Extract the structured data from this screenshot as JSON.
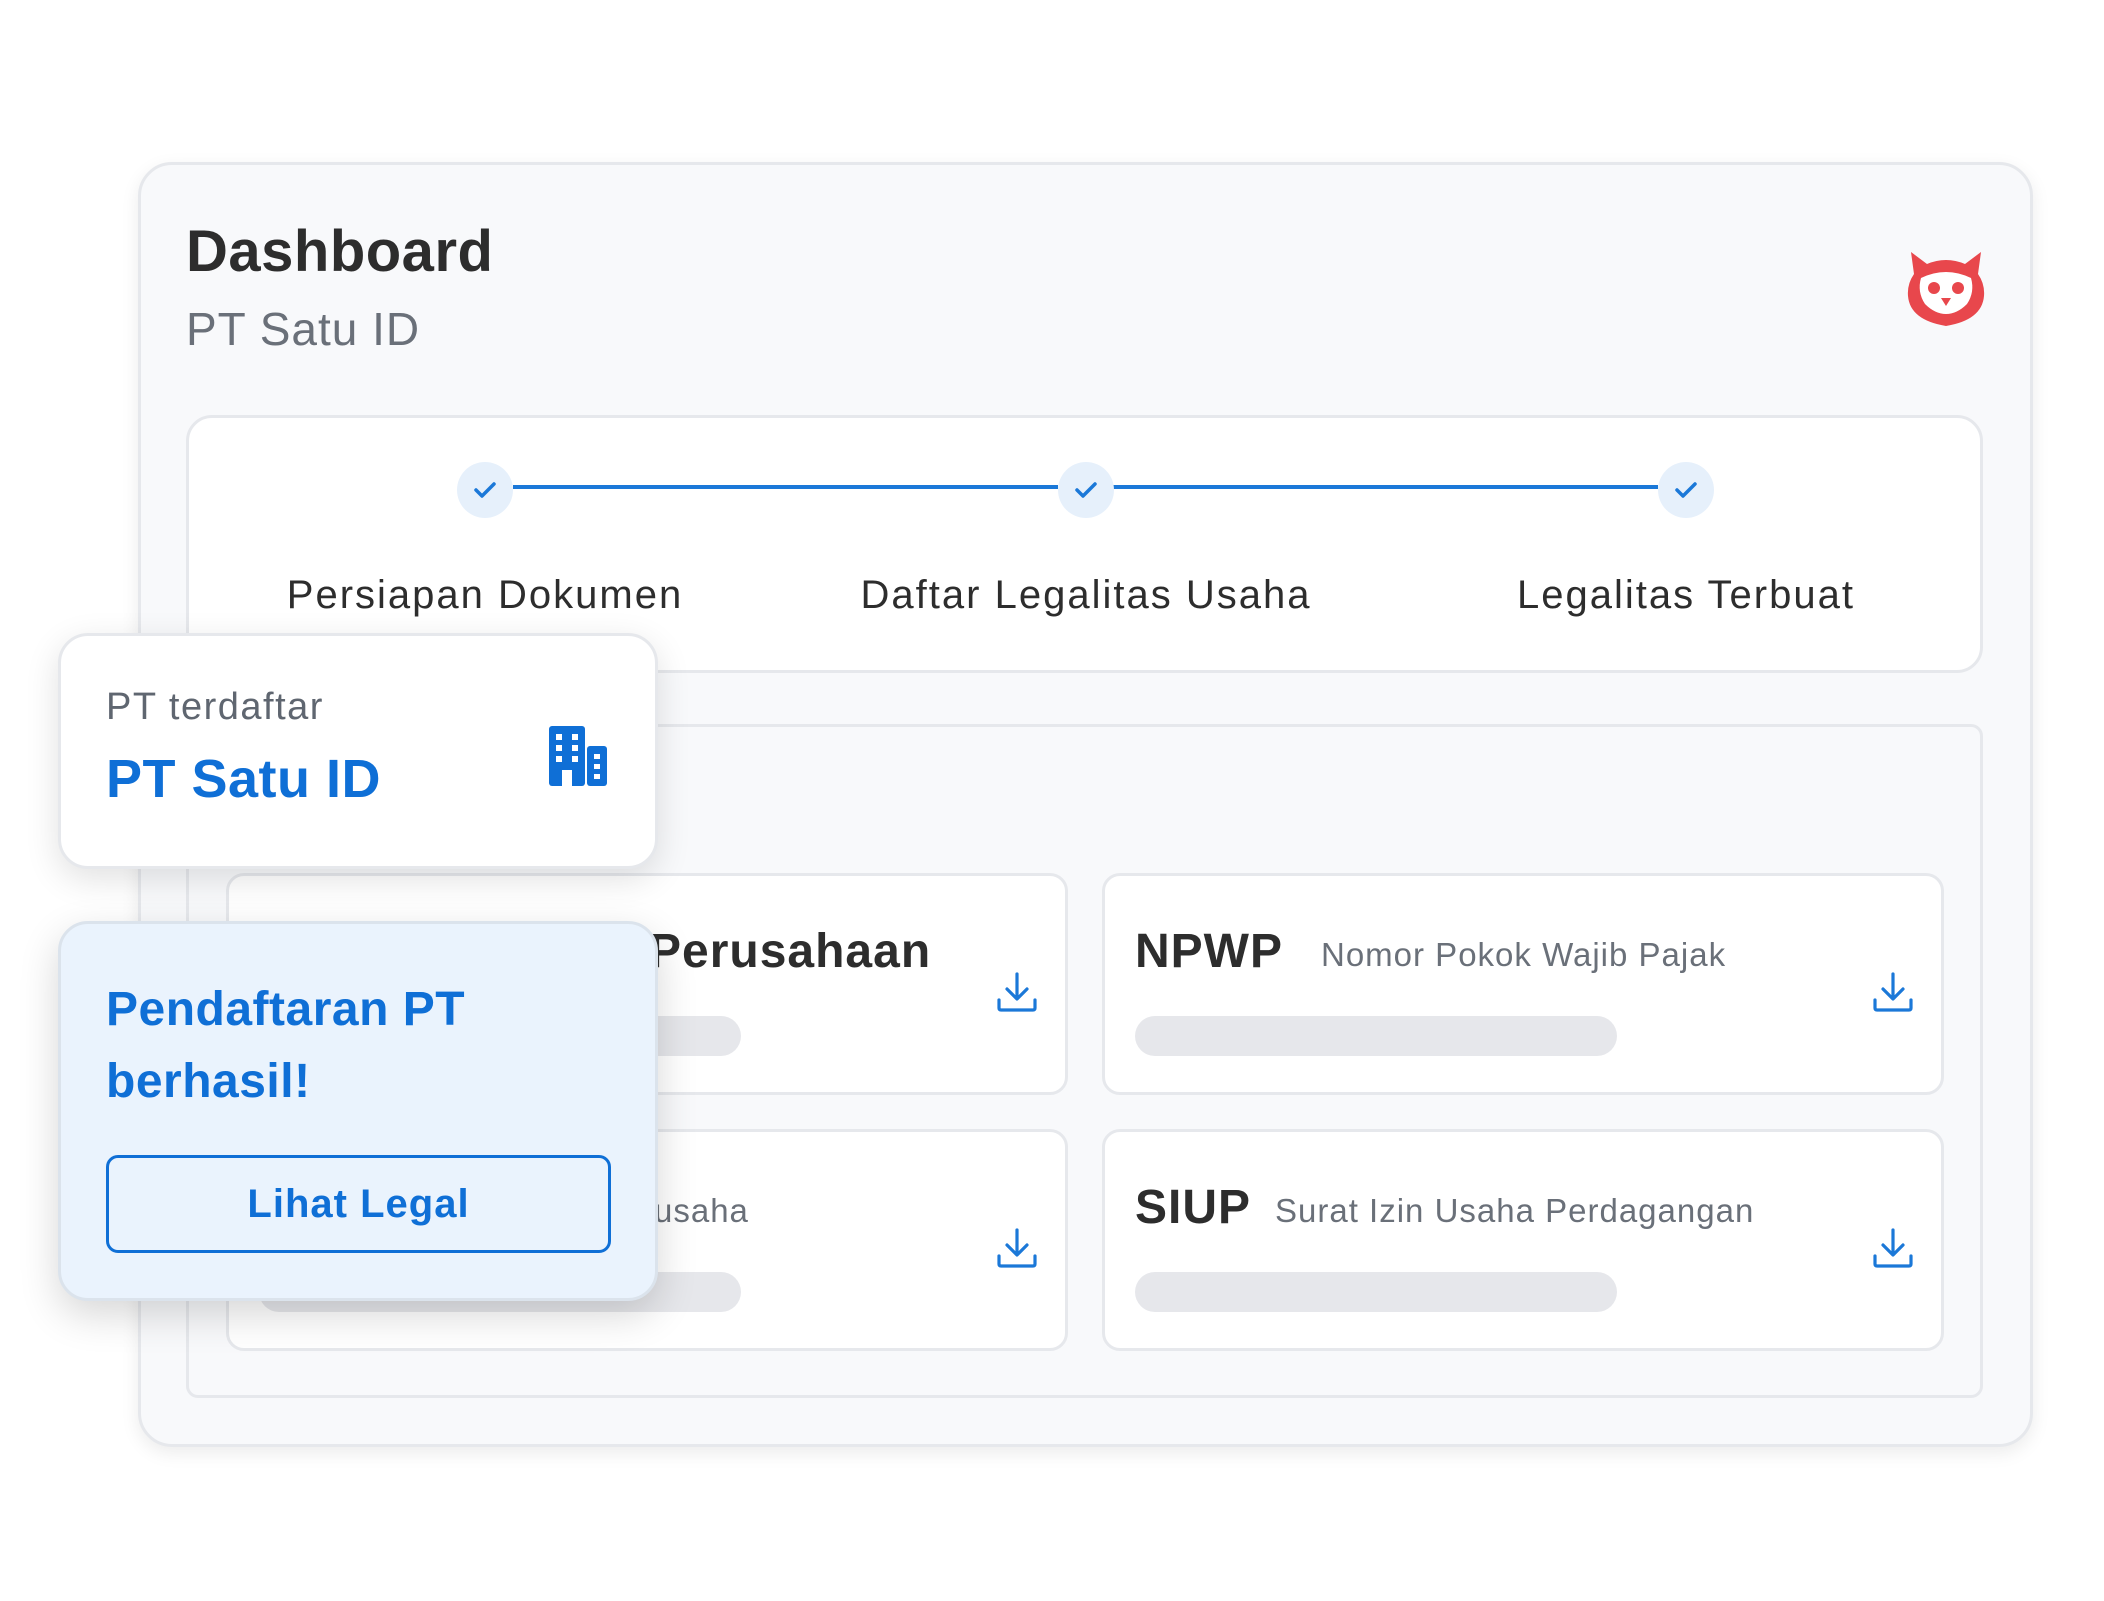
{
  "header": {
    "title": "Dashboard",
    "subtitle": "PT Satu ID",
    "logo_icon": "owl-logo-icon"
  },
  "stepper": {
    "steps": [
      {
        "label": "Persiapan Dokumen",
        "status": "completed"
      },
      {
        "label": "Daftar Legalitas Usaha",
        "status": "completed"
      },
      {
        "label": "Legalitas Terbuat",
        "status": "completed"
      }
    ]
  },
  "documents": [
    {
      "title": "",
      "title_suffix": "Perusahaan",
      "description": "",
      "icon": "download-icon"
    },
    {
      "title": "NPWP",
      "description": "Nomor Pokok Wajib Pajak",
      "icon": "download-icon"
    },
    {
      "title": "",
      "description_suffix": "usaha",
      "icon": "download-icon"
    },
    {
      "title": "SIUP",
      "description": "Surat Izin Usaha Perdagangan",
      "icon": "download-icon"
    }
  ],
  "registered_card": {
    "label": "PT terdaftar",
    "value": "PT Satu ID",
    "icon": "building-icon"
  },
  "success_card": {
    "title": "Pendaftaran PT berhasil!",
    "button_label": "Lihat Legal"
  },
  "colors": {
    "primary": "#0f6fd6",
    "brand_logo": "#e8474c",
    "skeleton": "#e6e7eb"
  }
}
